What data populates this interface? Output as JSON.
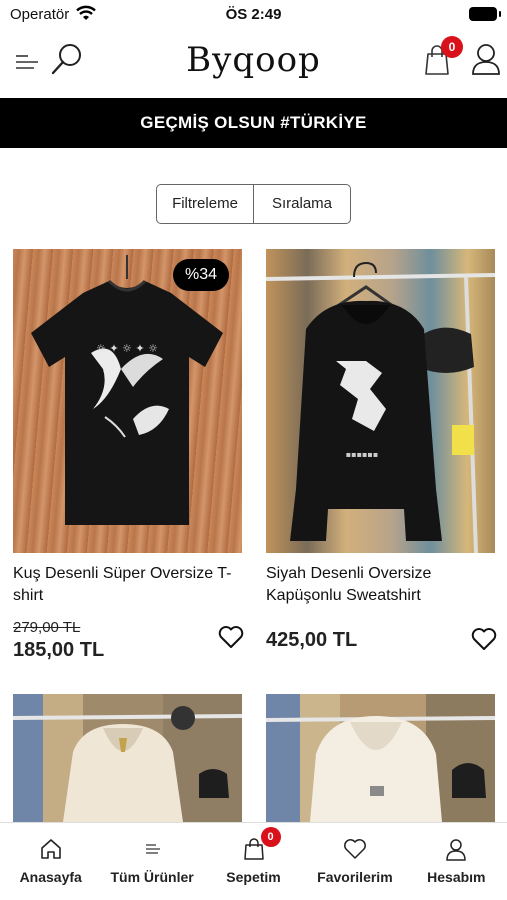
{
  "status_bar": {
    "carrier": "Operatör",
    "time": "ÖS 2:49"
  },
  "header": {
    "logo": "Byqoop",
    "cart_count": "0"
  },
  "banner": {
    "text": "GEÇMİŞ OLSUN #TÜRKİYE"
  },
  "controls": {
    "filter_label": "Filtreleme",
    "sort_label": "Sıralama"
  },
  "products": [
    {
      "name": "Kuş Desenli Süper Oversize T-shirt",
      "old_price": "279,00 TL",
      "price": "185,00 TL",
      "discount": "%34"
    },
    {
      "name": "Siyah Desenli Oversize Kapüşonlu Sweatshirt",
      "price": "425,00 TL"
    },
    {
      "name": ""
    },
    {
      "name": ""
    }
  ],
  "tabbar": {
    "items": [
      {
        "label": "Anasayfa",
        "icon": "home-icon"
      },
      {
        "label": "Tüm Ürünler",
        "icon": "list-icon"
      },
      {
        "label": "Sepetim",
        "icon": "bag-icon",
        "badge": "0"
      },
      {
        "label": "Favorilerim",
        "icon": "heart-icon"
      },
      {
        "label": "Hesabım",
        "icon": "user-icon"
      }
    ]
  },
  "colors": {
    "badge": "#d9111b",
    "banner_bg": "#000000",
    "accent_text": "#222222"
  }
}
